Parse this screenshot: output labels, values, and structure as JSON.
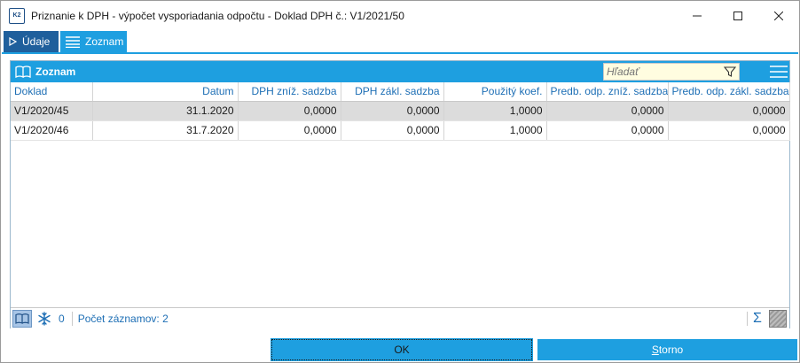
{
  "window": {
    "title": "Priznanie k DPH - výpočet vysporiadania odpočtu - Doklad DPH č.: V1/2021/50",
    "app_icon_text": "K2"
  },
  "tabs": [
    {
      "label": "Údaje",
      "icon": "play-icon",
      "active": false
    },
    {
      "label": "Zoznam",
      "icon": "list-icon",
      "active": true
    }
  ],
  "panel": {
    "title": "Zoznam",
    "search": {
      "placeholder": "Hľadať",
      "value": ""
    }
  },
  "table": {
    "columns": [
      "Doklad",
      "Datum",
      "DPH zníž. sadzba",
      "DPH zákl. sadzba",
      "Použitý koef.",
      "Predb. odp. zníž. sadzba",
      "Predb. odp. zákl. sadzba"
    ],
    "rows": [
      {
        "doklad": "V1/2020/45",
        "datum": "31.1.2020",
        "dph_zniz": "0,0000",
        "dph_zakl": "0,0000",
        "koef": "1,0000",
        "predb_zniz": "0,0000",
        "predb_zakl": "0,0000",
        "selected": true
      },
      {
        "doklad": "V1/2020/46",
        "datum": "31.7.2020",
        "dph_zniz": "0,0000",
        "dph_zakl": "0,0000",
        "koef": "1,0000",
        "predb_zniz": "0,0000",
        "predb_zakl": "0,0000",
        "selected": false
      }
    ]
  },
  "footer": {
    "frozen_count": "0",
    "record_count_label": "Počet záznamov: 2"
  },
  "buttons": {
    "ok": "OK",
    "storno_underlined": "S",
    "storno_rest": "torno"
  },
  "colors": {
    "accent": "#1e9fe0",
    "tab_dark": "#1f5f9c",
    "header_text": "#1e6fb5",
    "selected_row": "#dcdcdc"
  }
}
